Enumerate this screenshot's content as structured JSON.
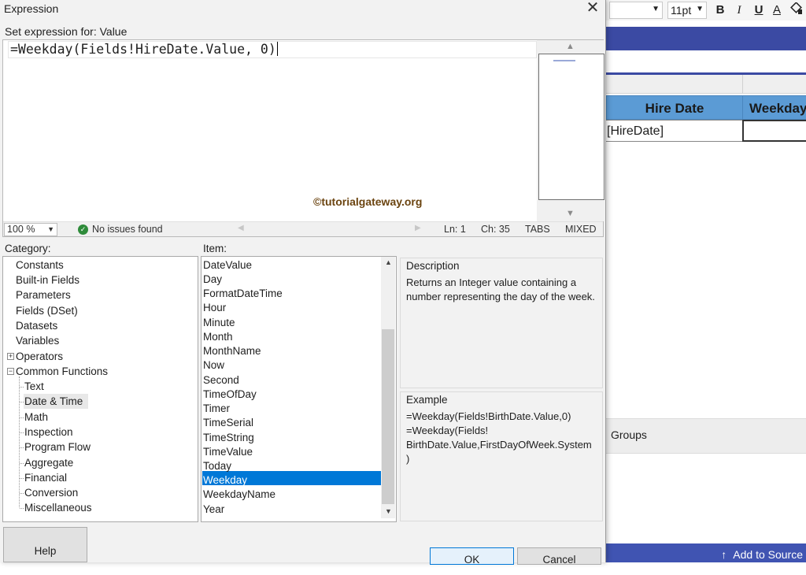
{
  "designer": {
    "font_size": "11pt",
    "toolbar": {
      "bold": "B",
      "italic": "I",
      "underline": "U",
      "font_color": "A"
    },
    "table": {
      "headers": [
        "Hire Date",
        "Weekday"
      ],
      "cells": [
        "[HireDate]",
        ""
      ]
    },
    "groups_label": "Groups",
    "status_action": "Add to Source"
  },
  "dialog": {
    "title": "Expression",
    "set_expression_label": "Set expression for: Value",
    "expression": "=Weekday(Fields!HireDate.Value, 0)",
    "watermark": "tutorialgateway.org",
    "status": {
      "zoom": "100 %",
      "issues": "No issues found",
      "line": "Ln: 1",
      "char": "Ch: 35",
      "tabs": "TABS",
      "mixed": "MIXED"
    },
    "category_label": "Category:",
    "categories": [
      "Constants",
      "Built-in Fields",
      "Parameters",
      "Fields (DSet)",
      "Datasets",
      "Variables",
      "Operators",
      "Common Functions"
    ],
    "subcategories": [
      "Text",
      "Date & Time",
      "Math",
      "Inspection",
      "Program Flow",
      "Aggregate",
      "Financial",
      "Conversion",
      "Miscellaneous"
    ],
    "selected_subcategory": "Date & Time",
    "item_label": "Item:",
    "items": [
      "DateValue",
      "Day",
      "FormatDateTime",
      "Hour",
      "Minute",
      "Month",
      "MonthName",
      "Now",
      "Second",
      "TimeOfDay",
      "Timer",
      "TimeSerial",
      "TimeString",
      "TimeValue",
      "Today",
      "Weekday",
      "WeekdayName",
      "Year"
    ],
    "selected_item": "Weekday",
    "description_title": "Description",
    "description": "Returns an Integer value containing a number representing the day of the week.",
    "example_title": "Example",
    "example_lines": [
      "=Weekday(Fields!BirthDate.Value,0)",
      "=Weekday(Fields!",
      "BirthDate.Value,FirstDayOfWeek.System",
      ")"
    ],
    "buttons": {
      "help": "Help",
      "ok": "OK",
      "cancel": "Cancel"
    }
  },
  "colors": {
    "accent": "#0078d7",
    "header_band": "#3b4aa3",
    "table_header": "#5b9bd5",
    "status_ok": "#2e8b3a"
  }
}
